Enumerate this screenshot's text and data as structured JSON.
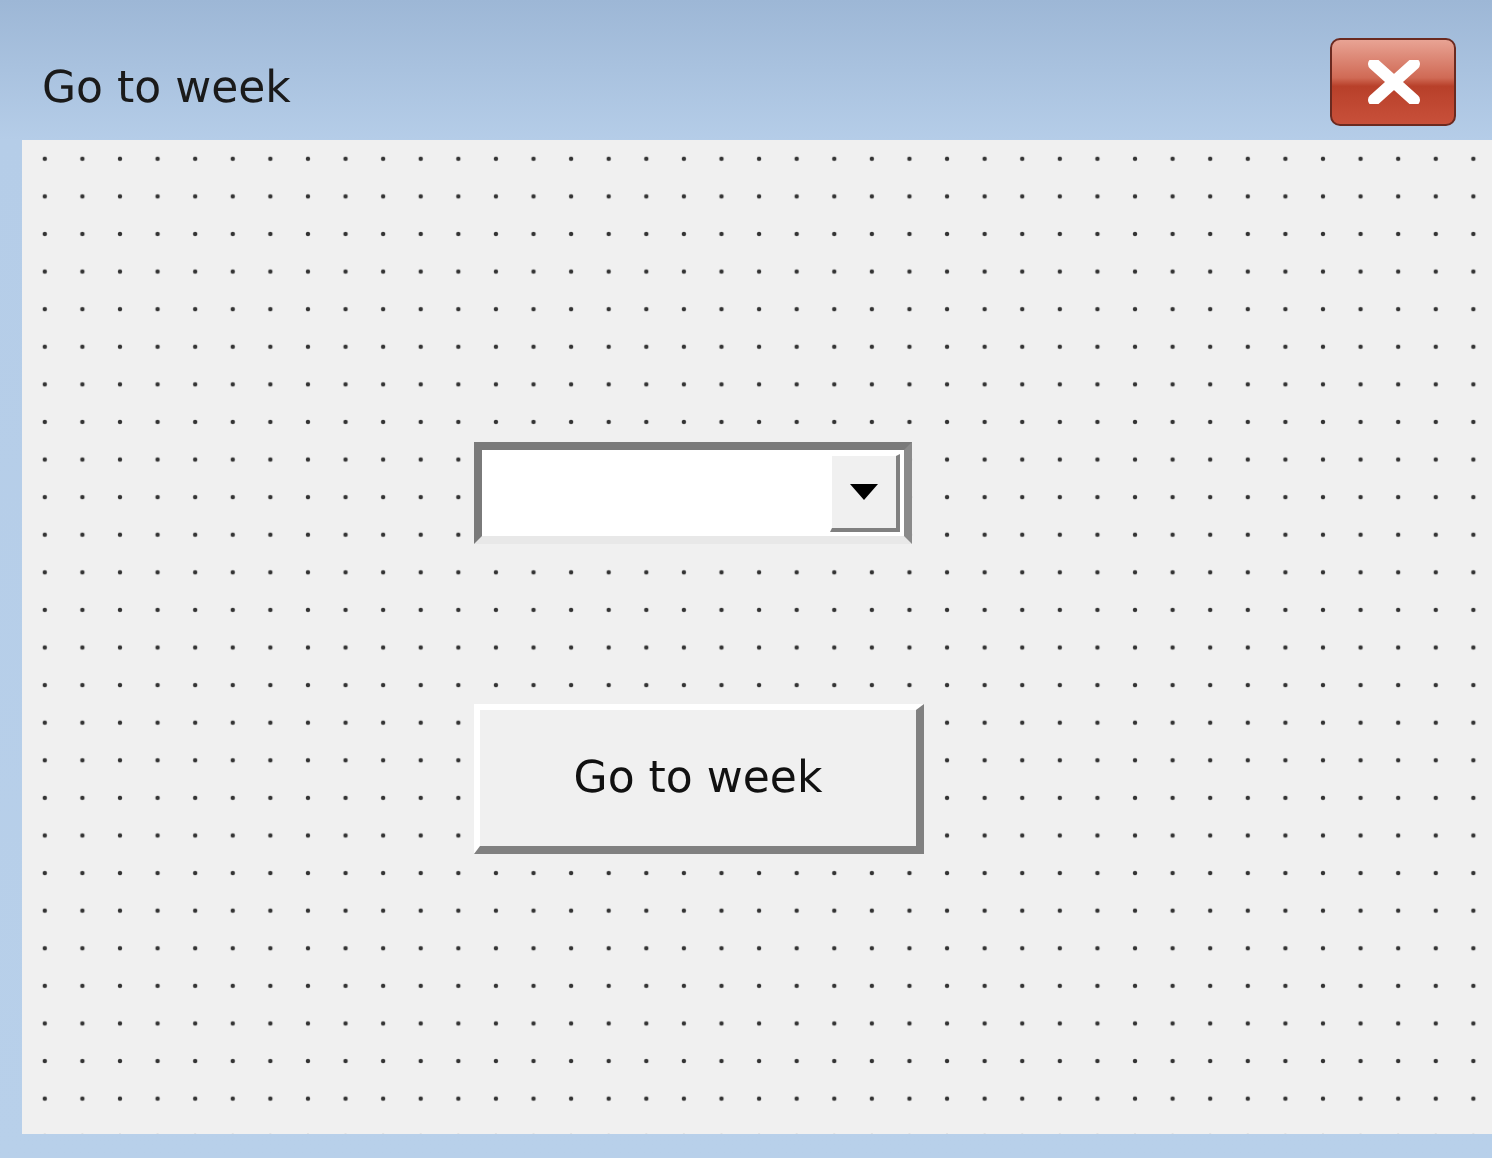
{
  "window": {
    "title": "Go to week"
  },
  "controls": [
    {
      "kind": "combo"
    },
    {
      "kind": "button",
      "label": "Go to week"
    }
  ]
}
